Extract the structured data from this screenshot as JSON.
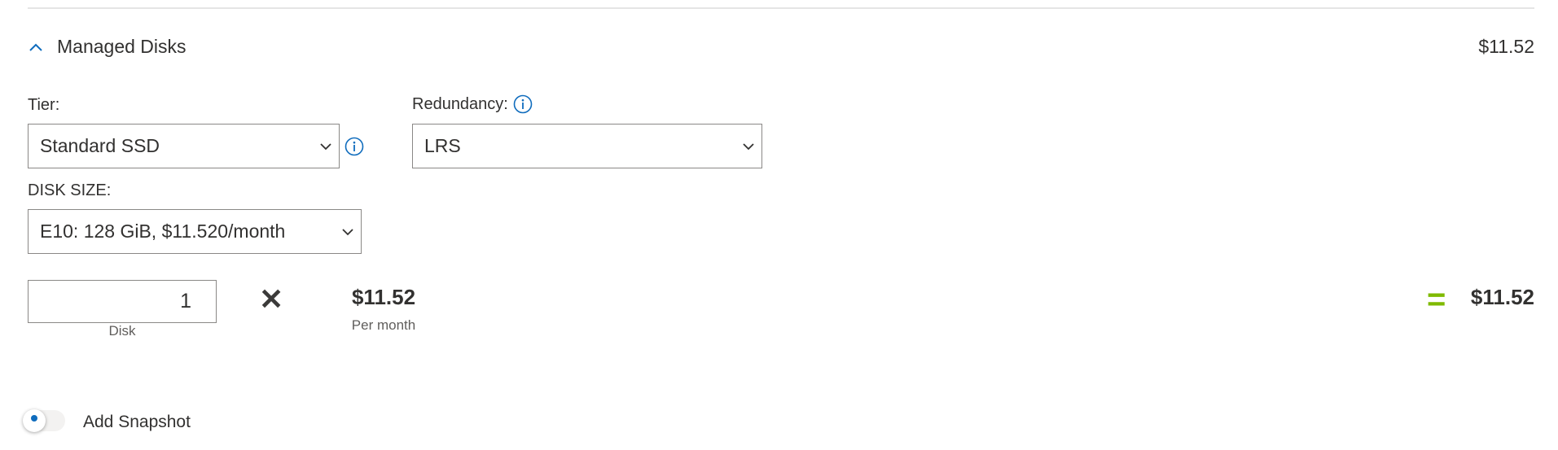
{
  "section": {
    "title": "Managed Disks",
    "total": "$11.52"
  },
  "tier": {
    "label": "Tier:",
    "value": "Standard SSD"
  },
  "redundancy": {
    "label": "Redundancy:",
    "value": "LRS"
  },
  "disk_size": {
    "label": "DISK SIZE:",
    "value": "E10: 128 GiB, $11.520/month"
  },
  "quantity": {
    "value": "1",
    "unit_label": "Disk"
  },
  "pricing": {
    "operator": "✕",
    "unit_price": "$11.52",
    "unit_period": "Per month",
    "equals": "=",
    "line_total": "$11.52"
  },
  "snapshot": {
    "label": "Add Snapshot",
    "enabled": false
  },
  "colors": {
    "accent": "#0f6cbd",
    "equals": "#7fba00",
    "text": "#323130",
    "border": "#8a8886"
  },
  "icons": {
    "collapse": "chevron-up-icon",
    "info": "info-icon",
    "dropdown": "chevron-down-icon",
    "multiply": "multiply-icon"
  }
}
